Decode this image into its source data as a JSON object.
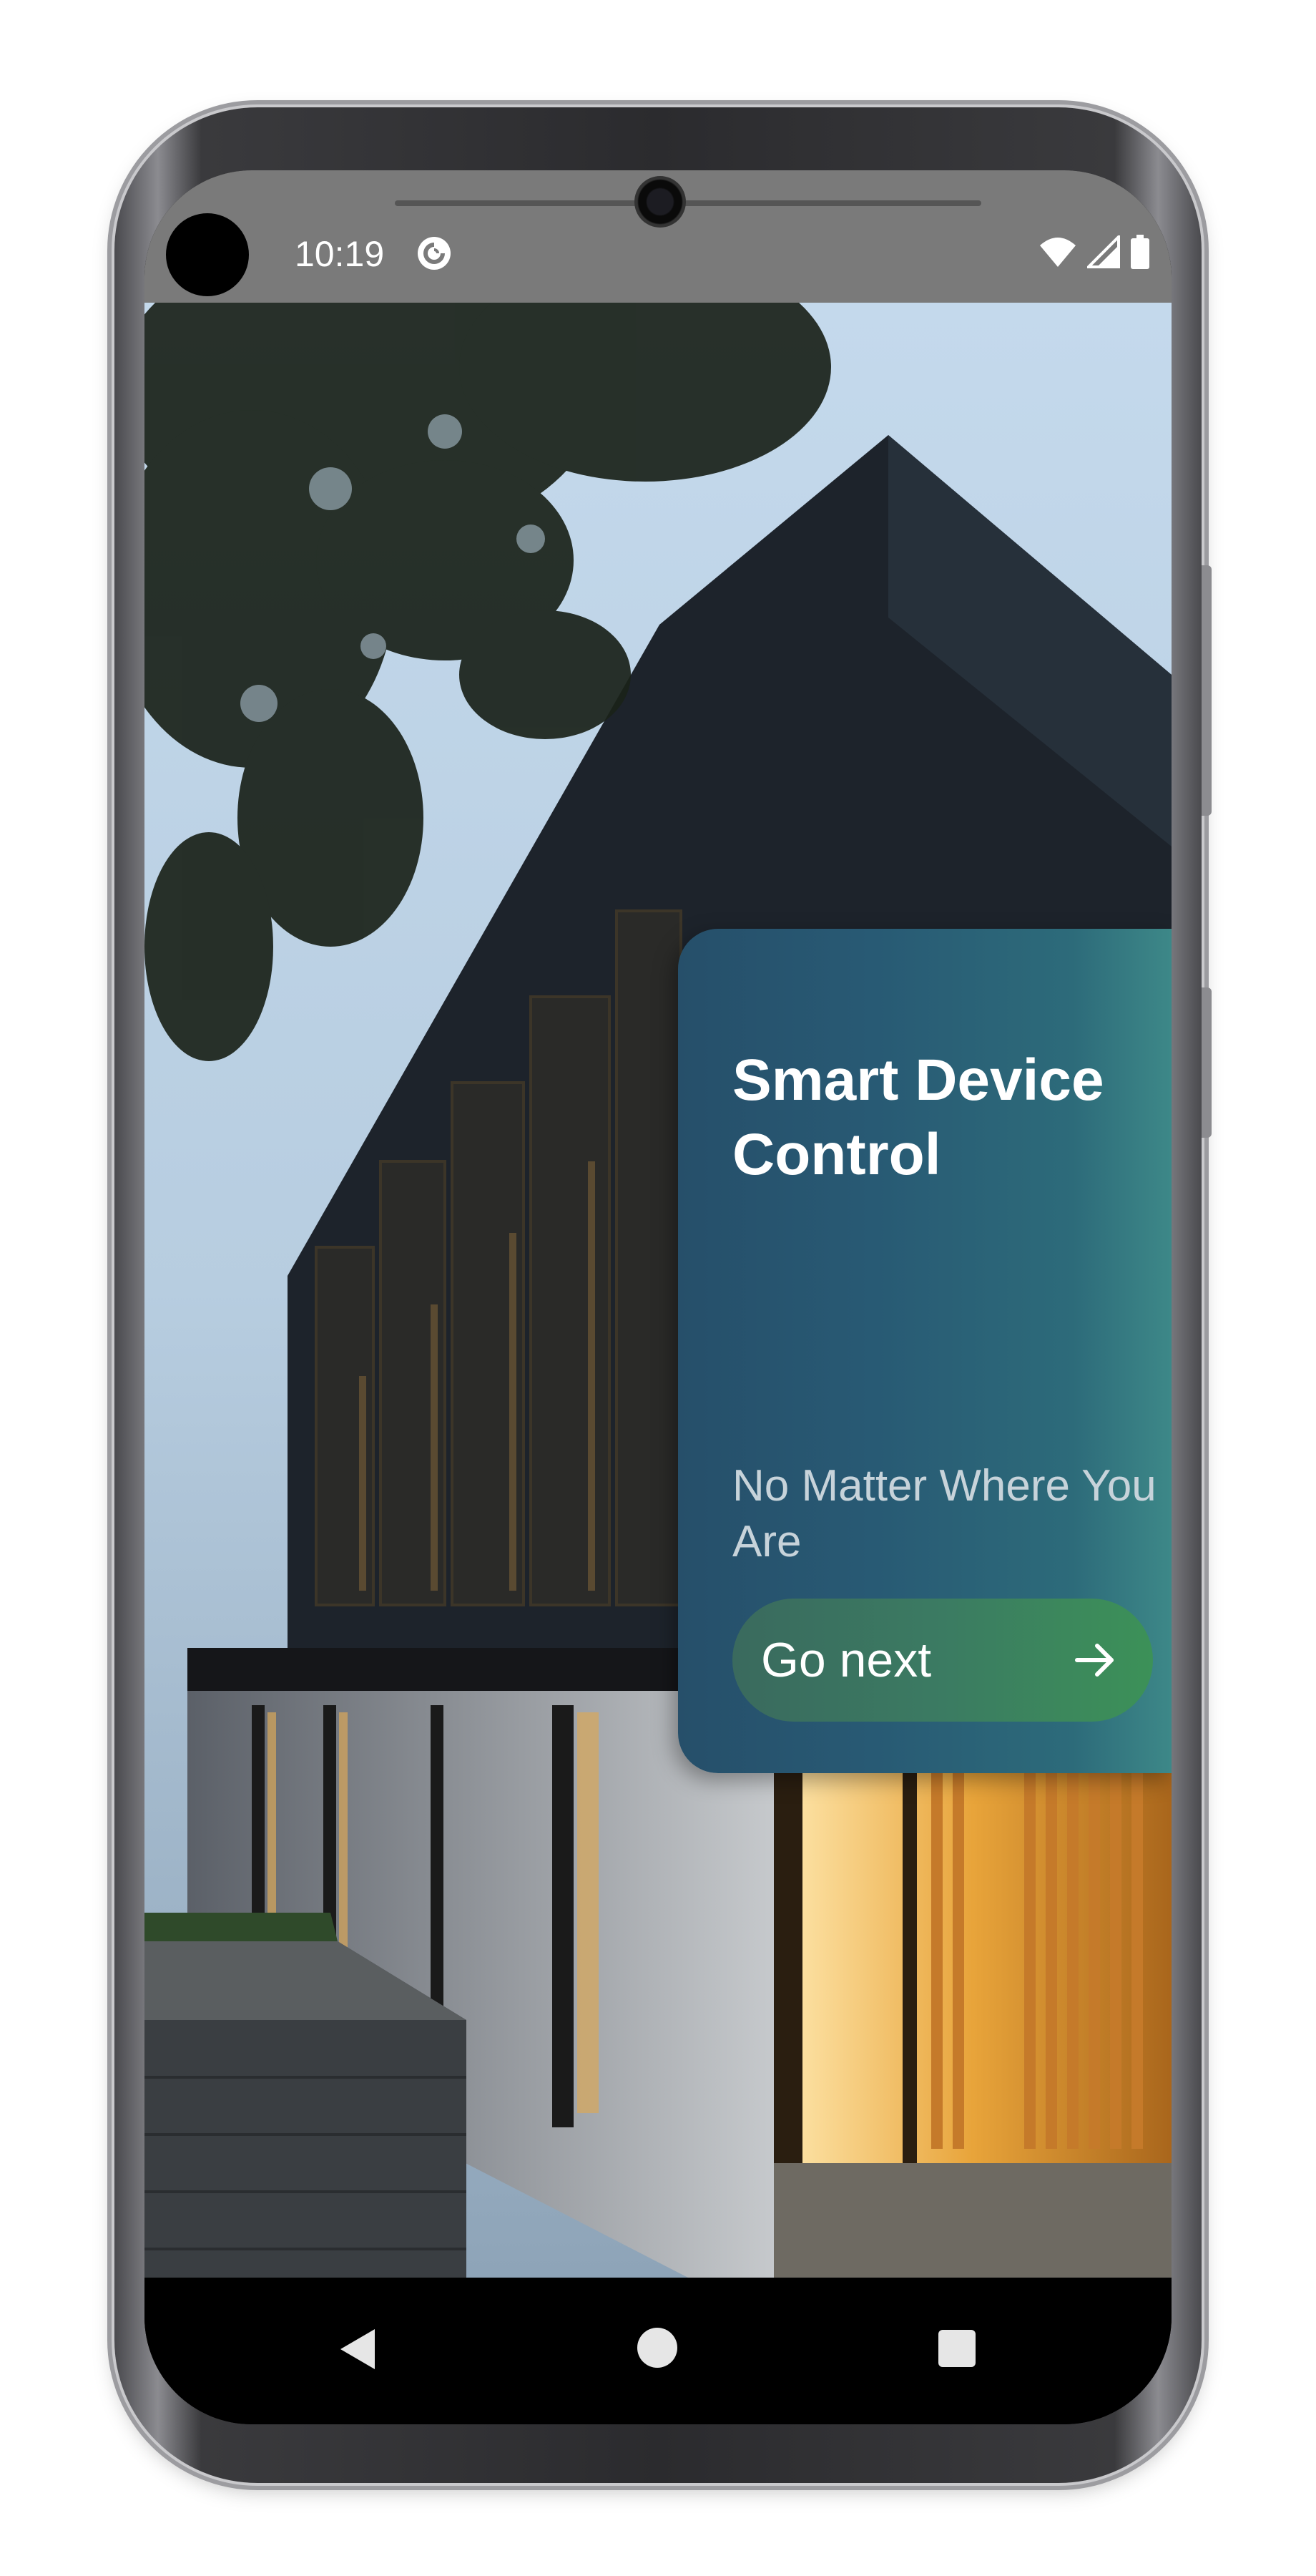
{
  "status_bar": {
    "time": "10:19",
    "app_icon": "pocket-casts-icon",
    "icons": [
      "wifi-icon",
      "cellular-signal-icon",
      "battery-icon"
    ]
  },
  "onboarding": {
    "title": "Smart Device Control",
    "subtitle": "No Matter Where You Are",
    "button_label": "Go next",
    "button_icon": "arrow-right-icon"
  },
  "nav_bar": {
    "icons": [
      "back-icon",
      "home-icon",
      "recents-icon"
    ]
  },
  "hero_image": "modern-house-exterior-photo",
  "colors": {
    "card_start": "#264f6a",
    "card_end": "#3d8888",
    "button_start": "#3a6a5e",
    "button_end": "#3c9158",
    "title_text": "#ffffff",
    "subtitle_text": "#c7d3da",
    "status_bar": "#7a7a7a"
  }
}
